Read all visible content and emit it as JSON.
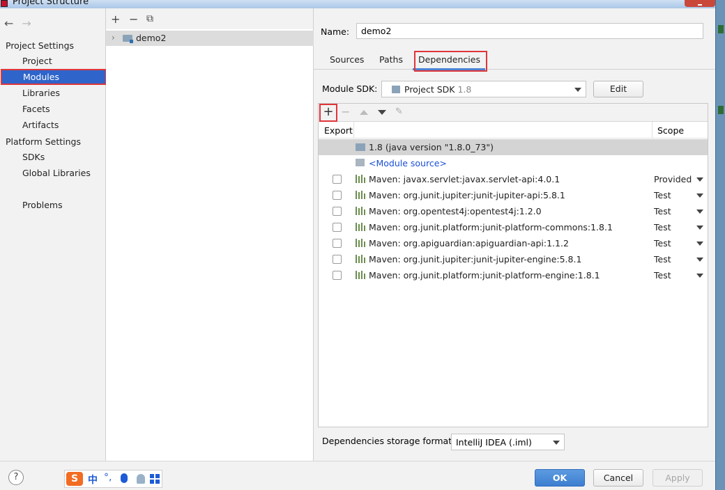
{
  "window": {
    "title": "Project Structure"
  },
  "sidebar": {
    "project_settings_header": "Project Settings",
    "platform_settings_header": "Platform Settings",
    "items": {
      "project": "Project",
      "modules": "Modules",
      "libraries": "Libraries",
      "facets": "Facets",
      "artifacts": "Artifacts",
      "sdks": "SDKs",
      "global_libraries": "Global Libraries",
      "problems": "Problems"
    },
    "selected": "Modules"
  },
  "module_tree": {
    "modules": [
      "demo2"
    ]
  },
  "module": {
    "name_label": "Name:",
    "name_value": "demo2",
    "tabs": [
      "Sources",
      "Paths",
      "Dependencies"
    ],
    "active_tab": "Dependencies",
    "sdk_label": "Module SDK:",
    "sdk_value": "Project SDK",
    "sdk_version": "1.8",
    "edit_label": "Edit",
    "table": {
      "col_export": "Export",
      "col_scope": "Scope",
      "jdk_row": "1.8 (java version \"1.8.0_73\")",
      "source_row": "<Module source>",
      "rows": [
        {
          "label": "Maven: javax.servlet:javax.servlet-api:4.0.1",
          "scope": "Provided"
        },
        {
          "label": "Maven: org.junit.jupiter:junit-jupiter-api:5.8.1",
          "scope": "Test"
        },
        {
          "label": "Maven: org.opentest4j:opentest4j:1.2.0",
          "scope": "Test"
        },
        {
          "label": "Maven: org.junit.platform:junit-platform-commons:1.8.1",
          "scope": "Test"
        },
        {
          "label": "Maven: org.apiguardian:apiguardian-api:1.1.2",
          "scope": "Test"
        },
        {
          "label": "Maven: org.junit.jupiter:junit-jupiter-engine:5.8.1",
          "scope": "Test"
        },
        {
          "label": "Maven: org.junit.platform:junit-platform-engine:1.8.1",
          "scope": "Test"
        }
      ]
    },
    "storage_format_label": "Dependencies storage format:",
    "storage_format_value": "IntelliJ IDEA (.iml)"
  },
  "footer": {
    "help": "?",
    "ok": "OK",
    "cancel": "Cancel",
    "apply": "Apply"
  },
  "ime_bar": {
    "logo": "S",
    "mode": "中",
    "punct": "°,"
  },
  "colors": {
    "selection": "#2f65ca",
    "highlight_red": "#e0353a",
    "ok_button": "#4a8ad8",
    "link": "#1a4fd6"
  },
  "icons": [
    "back-arrow-icon",
    "forward-arrow-icon",
    "add-icon",
    "remove-icon",
    "copy-icon",
    "folder-module-icon",
    "jdk-icon",
    "source-folder-icon",
    "maven-library-icon",
    "edit-pencil-icon",
    "dropdown-caret-icon",
    "help-icon"
  ]
}
